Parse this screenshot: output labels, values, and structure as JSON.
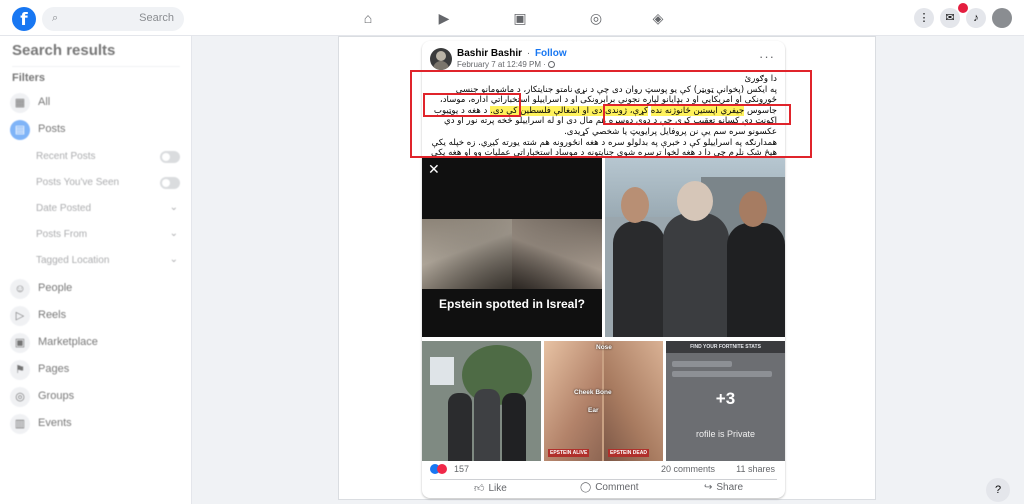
{
  "topbar": {
    "search_placeholder": "Search",
    "logo_letter": "f"
  },
  "sidebar": {
    "title": "Search results",
    "section": "Filters",
    "items": [
      {
        "label": "All",
        "icon": "grid-icon"
      },
      {
        "label": "Posts",
        "icon": "posts-icon",
        "active": true
      },
      {
        "label": "People",
        "icon": "people-icon"
      },
      {
        "label": "Reels",
        "icon": "reels-icon"
      },
      {
        "label": "Marketplace",
        "icon": "marketplace-icon"
      },
      {
        "label": "Pages",
        "icon": "pages-icon"
      },
      {
        "label": "Groups",
        "icon": "groups-icon"
      },
      {
        "label": "Events",
        "icon": "events-icon"
      }
    ],
    "sub_items": [
      {
        "label": "Recent Posts",
        "control": "toggle"
      },
      {
        "label": "Posts You've Seen",
        "control": "toggle"
      },
      {
        "label": "Date Posted",
        "control": "chevron"
      },
      {
        "label": "Posts From",
        "control": "chevron"
      },
      {
        "label": "Tagged Location",
        "control": "chevron"
      }
    ]
  },
  "post": {
    "author": "Bashir Bashir",
    "separator": "·",
    "follow_label": "Follow",
    "date": "February 7 at 12:49 PM ·",
    "more": "···",
    "text": {
      "line1": "دا وګورئ",
      "para_a": "په ایکس (پخوانې ټویټر) کې یو پوسټ روان دی چې د نړۍ نامتو جنایتکار، د ماشومانو جنسي ځورونکی او",
      "para_b": "امریکایي او د بډايانو لپاره نجونې برابرونکی او د اسراییلو استخباراتي اداره، موساد، جاسوس",
      "highlight_1": "جیفري اپستین ځانوژنه نده",
      "para_c": "کړې، ژوندی دی او اشغالې فلسطین کې دی",
      "highlight_2": "کړې، ژوندی دی او اشغالې فلسطین کې دی.",
      "para_d": "د هغه د یوټیوب اکونټ دې کسانو تعقیب کړی چې د دوي دوسره هم",
      "para_e": "مال دی او له اسراییلو څخه پرته نور او دي عکسونو سره سم یې نن پروفایل پرایویټ یا شخصي کړیدی.",
      "para_f": "همدارنګه په اسراییلو کې د خبرې په بدلولو سره د هغه انځورونه هم شته یورته کیږي. زه خپله یکې هیڅ شک",
      "para_g": "نلرم چې دا د هغه لخوا ترسره شوې جنایتونه د موساد استخباراتي عملیات وو او هغه یکې بوازې لوبغاړی وو."
    },
    "media": {
      "tile1_caption": "Epstein spotted in Isreal?",
      "tile1_close": "✕",
      "tile4_labels": [
        "Nose",
        "Cheek Bone",
        "Ear"
      ],
      "tile4_caps": [
        "EPSTEIN ALIVE",
        "EPSTEIN DEAD"
      ],
      "tile5_header": "FIND YOUR FORTNITE STATS",
      "tile5_more": "+3",
      "tile5_private": "rofile is Private"
    },
    "stats": {
      "reactions": "157",
      "comments": "20 comments",
      "shares": "11 shares"
    },
    "actions": {
      "like": "Like",
      "comment": "Comment",
      "share": "Share"
    }
  },
  "colors": {
    "brand": "#1877f2",
    "highlight": "#fff25c",
    "annotation_box": "#e0242b"
  }
}
